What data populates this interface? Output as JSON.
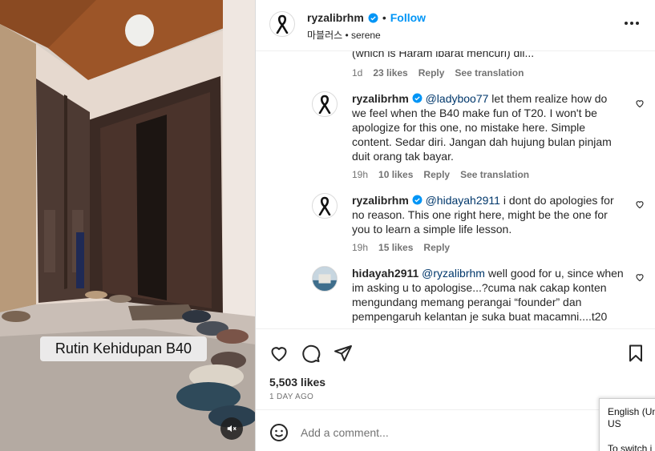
{
  "media": {
    "caption": "Rutin Kehidupan B40",
    "mute_icon": "speaker-muted-icon"
  },
  "header": {
    "username": "ryzalibrhm",
    "separator": "•",
    "follow_label": "Follow",
    "subtitle": "마블러스 • serene"
  },
  "comments": {
    "truncated_text": "(which is Haram ibarat mencuri) dll...",
    "truncated_meta": {
      "age": "1d",
      "likes": "23 likes",
      "reply": "Reply",
      "translate": "See translation"
    },
    "items": [
      {
        "username": "ryzalibrhm",
        "mention": "@ladyboo77",
        "text": " let them realize how do we feel when the B40 make fun of T20. I won't be apologize for this one, no mistake here. Simple content. Sedar diri. Jangan dah hujung bulan pinjam duit orang tak bayar.",
        "age": "19h",
        "likes": "10 likes",
        "reply": "Reply",
        "translate": "See translation"
      },
      {
        "username": "ryzalibrhm",
        "mention": "@hidayah2911",
        "text": " i dont do apologies for no reason. This one right here, might be the one for you to learn a simple life lesson.",
        "age": "19h",
        "likes": "15 likes",
        "reply": "Reply"
      },
      {
        "username": "hidayah2911",
        "mention": "@ryzalibrhm",
        "text": " well good for u, since when im asking u to apologise...?cuma nak cakap konten mengundang memang perangai “founder” dan pempengaruh kelantan je suka buat macamni....t20"
      }
    ]
  },
  "actions": {
    "likes": "5,503 likes",
    "date": "1 DAY AGO"
  },
  "add_comment": {
    "placeholder": "Add a comment..."
  },
  "language_popup": {
    "line1": "English (Un",
    "line2": "US",
    "line3": "To switch i"
  },
  "colors": {
    "accent": "#0095f6",
    "verified": "#0095f6",
    "mention": "#00376b",
    "muted_text": "#737373"
  }
}
